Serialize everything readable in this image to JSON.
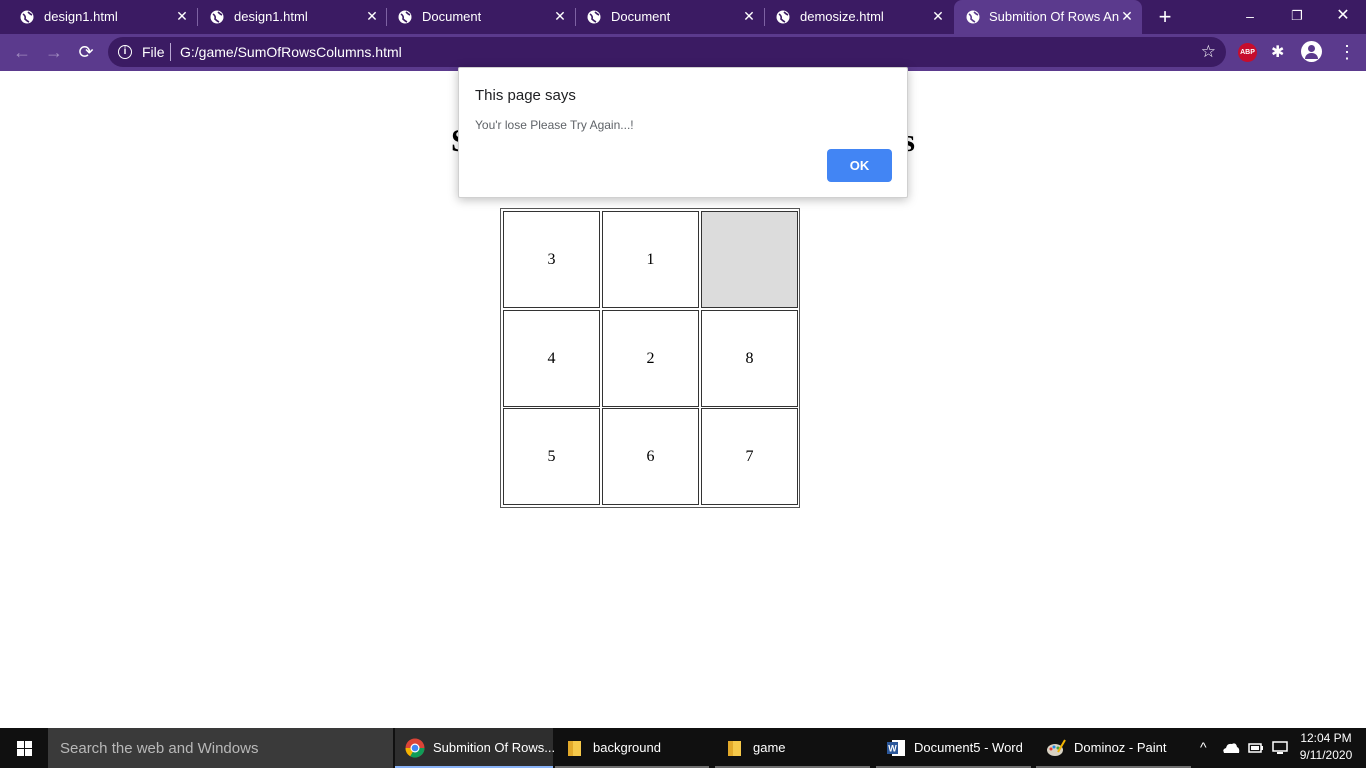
{
  "browser": {
    "tabs": [
      {
        "title": "design1.html",
        "active": false
      },
      {
        "title": "design1.html",
        "active": false
      },
      {
        "title": "Document",
        "active": false
      },
      {
        "title": "Document",
        "active": false
      },
      {
        "title": "demosize.html",
        "active": false
      },
      {
        "title": "Submition Of Rows Anc",
        "active": true
      }
    ],
    "new_tab_icon": "plus-icon",
    "window_controls": {
      "minimize": "–",
      "restore": "❐",
      "close": "✕"
    },
    "toolbar": {
      "back_icon": "←",
      "forward_icon": "→",
      "reload_icon": "⟳",
      "info_icon": "i",
      "scheme_label": "File",
      "url": "G:/game/SumOfRowsColumns.html",
      "star_icon": "☆",
      "abp_label": "ABP",
      "extensions_icon": "✱",
      "menu_icon": "⋮"
    },
    "accent_color": "#5b3a8d",
    "tabstrip_color": "#3b1b63"
  },
  "page": {
    "heading_start": "S",
    "heading_end": "s",
    "grid": [
      [
        "3",
        "1",
        ""
      ],
      [
        "4",
        "2",
        "8"
      ],
      [
        "5",
        "6",
        "7"
      ]
    ]
  },
  "alert": {
    "title": "This page says",
    "message": "You'r lose Please Try Again...!",
    "ok_label": "OK",
    "ok_color": "#4285f4"
  },
  "taskbar": {
    "search_placeholder": "Search the web and Windows",
    "items": [
      {
        "label": "Submition Of Rows...",
        "icon": "chrome-icon",
        "active": true
      },
      {
        "label": "background",
        "icon": "folder-icon",
        "active": false
      },
      {
        "label": "game",
        "icon": "folder-icon",
        "active": false
      },
      {
        "label": "Document5 - Word",
        "icon": "word-icon",
        "active": false
      },
      {
        "label": "Dominoz - Paint",
        "icon": "paint-icon",
        "active": false
      }
    ],
    "tray": {
      "chevron": "^"
    },
    "clock": {
      "time": "12:04 PM",
      "date": "9/11/2020"
    }
  }
}
